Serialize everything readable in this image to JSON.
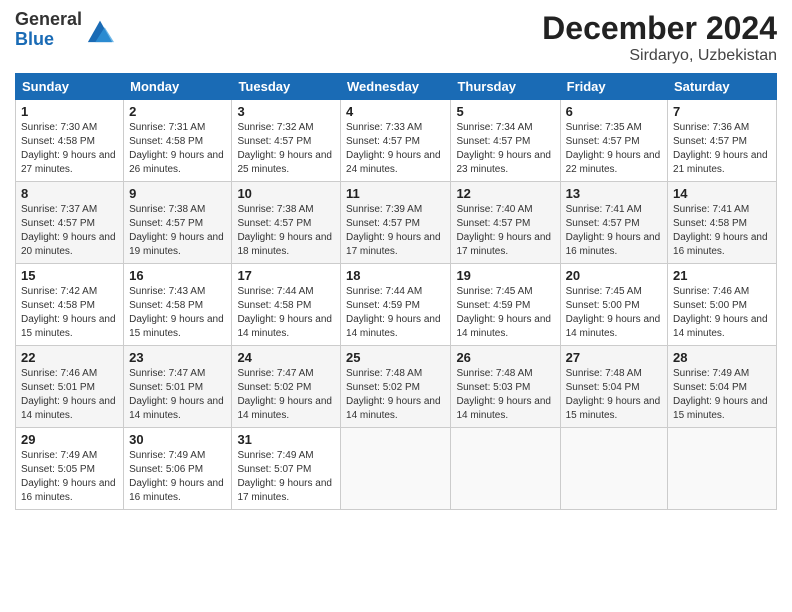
{
  "logo": {
    "general": "General",
    "blue": "Blue"
  },
  "title": "December 2024",
  "location": "Sirdaryo, Uzbekistan",
  "days_of_week": [
    "Sunday",
    "Monday",
    "Tuesday",
    "Wednesday",
    "Thursday",
    "Friday",
    "Saturday"
  ],
  "weeks": [
    [
      {
        "day": "1",
        "sunrise": "7:30 AM",
        "sunset": "4:58 PM",
        "daylight": "9 hours and 27 minutes."
      },
      {
        "day": "2",
        "sunrise": "7:31 AM",
        "sunset": "4:58 PM",
        "daylight": "9 hours and 26 minutes."
      },
      {
        "day": "3",
        "sunrise": "7:32 AM",
        "sunset": "4:57 PM",
        "daylight": "9 hours and 25 minutes."
      },
      {
        "day": "4",
        "sunrise": "7:33 AM",
        "sunset": "4:57 PM",
        "daylight": "9 hours and 24 minutes."
      },
      {
        "day": "5",
        "sunrise": "7:34 AM",
        "sunset": "4:57 PM",
        "daylight": "9 hours and 23 minutes."
      },
      {
        "day": "6",
        "sunrise": "7:35 AM",
        "sunset": "4:57 PM",
        "daylight": "9 hours and 22 minutes."
      },
      {
        "day": "7",
        "sunrise": "7:36 AM",
        "sunset": "4:57 PM",
        "daylight": "9 hours and 21 minutes."
      }
    ],
    [
      {
        "day": "8",
        "sunrise": "7:37 AM",
        "sunset": "4:57 PM",
        "daylight": "9 hours and 20 minutes."
      },
      {
        "day": "9",
        "sunrise": "7:38 AM",
        "sunset": "4:57 PM",
        "daylight": "9 hours and 19 minutes."
      },
      {
        "day": "10",
        "sunrise": "7:38 AM",
        "sunset": "4:57 PM",
        "daylight": "9 hours and 18 minutes."
      },
      {
        "day": "11",
        "sunrise": "7:39 AM",
        "sunset": "4:57 PM",
        "daylight": "9 hours and 17 minutes."
      },
      {
        "day": "12",
        "sunrise": "7:40 AM",
        "sunset": "4:57 PM",
        "daylight": "9 hours and 17 minutes."
      },
      {
        "day": "13",
        "sunrise": "7:41 AM",
        "sunset": "4:57 PM",
        "daylight": "9 hours and 16 minutes."
      },
      {
        "day": "14",
        "sunrise": "7:41 AM",
        "sunset": "4:58 PM",
        "daylight": "9 hours and 16 minutes."
      }
    ],
    [
      {
        "day": "15",
        "sunrise": "7:42 AM",
        "sunset": "4:58 PM",
        "daylight": "9 hours and 15 minutes."
      },
      {
        "day": "16",
        "sunrise": "7:43 AM",
        "sunset": "4:58 PM",
        "daylight": "9 hours and 15 minutes."
      },
      {
        "day": "17",
        "sunrise": "7:44 AM",
        "sunset": "4:58 PM",
        "daylight": "9 hours and 14 minutes."
      },
      {
        "day": "18",
        "sunrise": "7:44 AM",
        "sunset": "4:59 PM",
        "daylight": "9 hours and 14 minutes."
      },
      {
        "day": "19",
        "sunrise": "7:45 AM",
        "sunset": "4:59 PM",
        "daylight": "9 hours and 14 minutes."
      },
      {
        "day": "20",
        "sunrise": "7:45 AM",
        "sunset": "5:00 PM",
        "daylight": "9 hours and 14 minutes."
      },
      {
        "day": "21",
        "sunrise": "7:46 AM",
        "sunset": "5:00 PM",
        "daylight": "9 hours and 14 minutes."
      }
    ],
    [
      {
        "day": "22",
        "sunrise": "7:46 AM",
        "sunset": "5:01 PM",
        "daylight": "9 hours and 14 minutes."
      },
      {
        "day": "23",
        "sunrise": "7:47 AM",
        "sunset": "5:01 PM",
        "daylight": "9 hours and 14 minutes."
      },
      {
        "day": "24",
        "sunrise": "7:47 AM",
        "sunset": "5:02 PM",
        "daylight": "9 hours and 14 minutes."
      },
      {
        "day": "25",
        "sunrise": "7:48 AM",
        "sunset": "5:02 PM",
        "daylight": "9 hours and 14 minutes."
      },
      {
        "day": "26",
        "sunrise": "7:48 AM",
        "sunset": "5:03 PM",
        "daylight": "9 hours and 14 minutes."
      },
      {
        "day": "27",
        "sunrise": "7:48 AM",
        "sunset": "5:04 PM",
        "daylight": "9 hours and 15 minutes."
      },
      {
        "day": "28",
        "sunrise": "7:49 AM",
        "sunset": "5:04 PM",
        "daylight": "9 hours and 15 minutes."
      }
    ],
    [
      {
        "day": "29",
        "sunrise": "7:49 AM",
        "sunset": "5:05 PM",
        "daylight": "9 hours and 16 minutes."
      },
      {
        "day": "30",
        "sunrise": "7:49 AM",
        "sunset": "5:06 PM",
        "daylight": "9 hours and 16 minutes."
      },
      {
        "day": "31",
        "sunrise": "7:49 AM",
        "sunset": "5:07 PM",
        "daylight": "9 hours and 17 minutes."
      },
      null,
      null,
      null,
      null
    ]
  ]
}
